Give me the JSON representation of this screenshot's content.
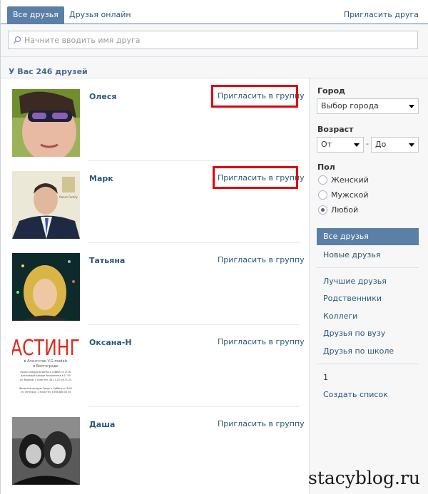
{
  "tabs": {
    "all_friends": "Все друзья",
    "online": "Друзья онлайн",
    "invite": "Пригласить друга"
  },
  "search": {
    "placeholder": "Начните вводить имя друга"
  },
  "summary": {
    "count_text": "У Вас 246 друзей"
  },
  "friends": [
    {
      "name": "Олеся",
      "action": "Пригласить в группу",
      "highlighted": true
    },
    {
      "name": "Марк",
      "action": "Пригласить в группу",
      "highlighted": true
    },
    {
      "name": "Татьяна",
      "action": "Пригласить в группу",
      "highlighted": false
    },
    {
      "name": "Оксана-Н",
      "action": "Пригласить в группу",
      "highlighted": false
    },
    {
      "name": "Даша",
      "action": "Пригласить в группу",
      "highlighted": false
    }
  ],
  "photo4_text": {
    "big": "АСТИНГ",
    "line1": "в Агентство V.G.models",
    "line2": "в Волгограде",
    "line3": "вушек каждую Вторник и Субботу в 17:00",
    "line4": "для каждой каждое Воскресенье в 17:00",
    "line5": "ул. Мирной, 1 этаж тел. 49-71-23, 49-71-24",
    "line6": "Волжском каждую Среду и Субботу в 18:00",
    "line7": "ул. Энгельса, 1 этаж тел. 8 908 880 00 00"
  },
  "photo2_logo": "Rosso Family",
  "filters": {
    "city_label": "Город",
    "city_value": "Выбор города",
    "age_label": "Возраст",
    "age_from": "От",
    "age_dash": "-",
    "age_to": "До",
    "sex_label": "Пол",
    "sex_options": [
      "Женский",
      "Мужской",
      "Любой"
    ],
    "sex_selected": "Любой"
  },
  "sidebar_nav": {
    "active": "Все друзья",
    "new": "Новые друзья",
    "lists": [
      "Лучшие друзья",
      "Родственники",
      "Коллеги",
      "Друзья по вузу",
      "Друзья по школе"
    ],
    "page_number": "1",
    "create_list": "Создать список"
  },
  "colors": {
    "accent": "#5b7fa6",
    "link": "#2b587a",
    "highlight": "#e3000b"
  },
  "watermark": "stacyblog.ru"
}
